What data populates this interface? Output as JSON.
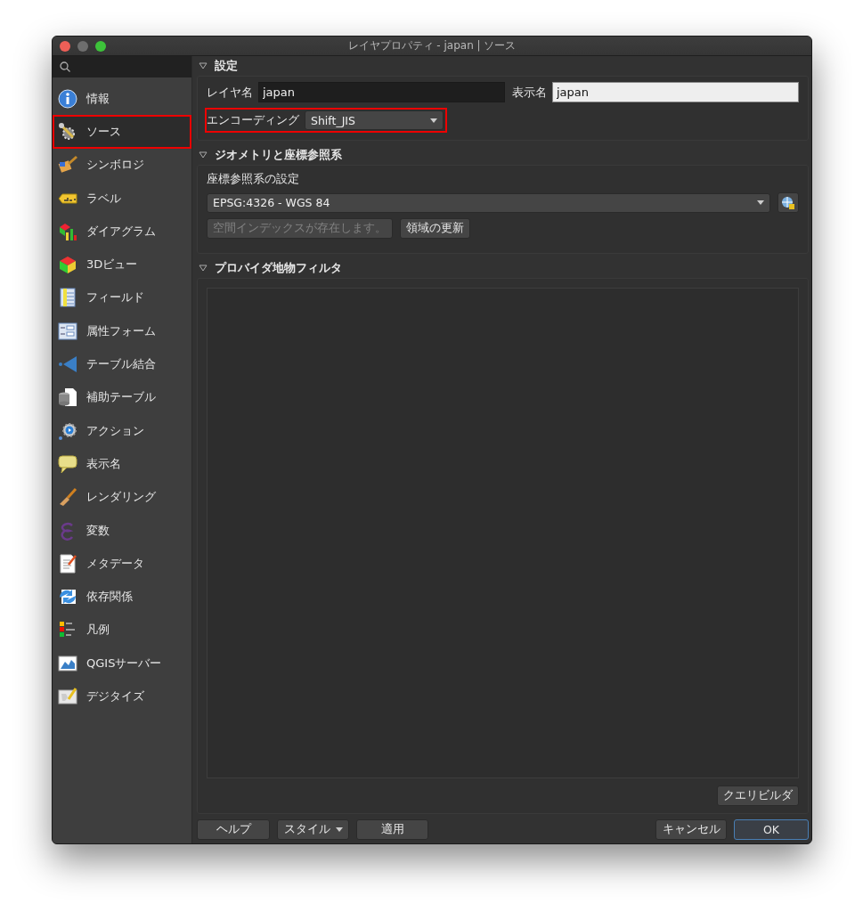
{
  "window": {
    "title": "レイヤプロパティ - japan | ソース"
  },
  "sidebar": {
    "items": [
      {
        "label": "情報",
        "selected": false,
        "highlighted": false
      },
      {
        "label": "ソース",
        "selected": true,
        "highlighted": true
      },
      {
        "label": "シンボロジ",
        "selected": false,
        "highlighted": false
      },
      {
        "label": "ラベル",
        "selected": false,
        "highlighted": false
      },
      {
        "label": "ダイアグラム",
        "selected": false,
        "highlighted": false
      },
      {
        "label": "3Dビュー",
        "selected": false,
        "highlighted": false
      },
      {
        "label": "フィールド",
        "selected": false,
        "highlighted": false
      },
      {
        "label": "属性フォーム",
        "selected": false,
        "highlighted": false
      },
      {
        "label": "テーブル結合",
        "selected": false,
        "highlighted": false
      },
      {
        "label": "補助テーブル",
        "selected": false,
        "highlighted": false
      },
      {
        "label": "アクション",
        "selected": false,
        "highlighted": false
      },
      {
        "label": "表示名",
        "selected": false,
        "highlighted": false
      },
      {
        "label": "レンダリング",
        "selected": false,
        "highlighted": false
      },
      {
        "label": "変数",
        "selected": false,
        "highlighted": false
      },
      {
        "label": "メタデータ",
        "selected": false,
        "highlighted": false
      },
      {
        "label": "依存関係",
        "selected": false,
        "highlighted": false
      },
      {
        "label": "凡例",
        "selected": false,
        "highlighted": false
      },
      {
        "label": "QGISサーバー",
        "selected": false,
        "highlighted": false
      },
      {
        "label": "デジタイズ",
        "selected": false,
        "highlighted": false
      }
    ]
  },
  "settings": {
    "title": "設定",
    "expanded": true,
    "layer_name_label": "レイヤ名",
    "layer_name": "japan",
    "display_name_label": "表示名",
    "display_name": "japan",
    "encoding_label": "エンコーディング",
    "encoding": "Shift_JIS",
    "encoding_highlighted": true
  },
  "geometry": {
    "title": "ジオメトリと座標参照系",
    "expanded": true,
    "crs_label": "座標参照系の設定",
    "crs": "EPSG:4326 - WGS 84",
    "index_button": {
      "label": "空間インデックスが存在します。",
      "disabled": true
    },
    "extent_button": {
      "label": "領域の更新",
      "disabled": false
    }
  },
  "filter": {
    "title": "プロバイダ地物フィルタ",
    "expanded": true,
    "query_builder": "クエリビルダ"
  },
  "buttons": {
    "help": "ヘルプ",
    "style": "スタイル",
    "apply": "適用",
    "cancel": "キャンセル",
    "ok": "OK"
  }
}
